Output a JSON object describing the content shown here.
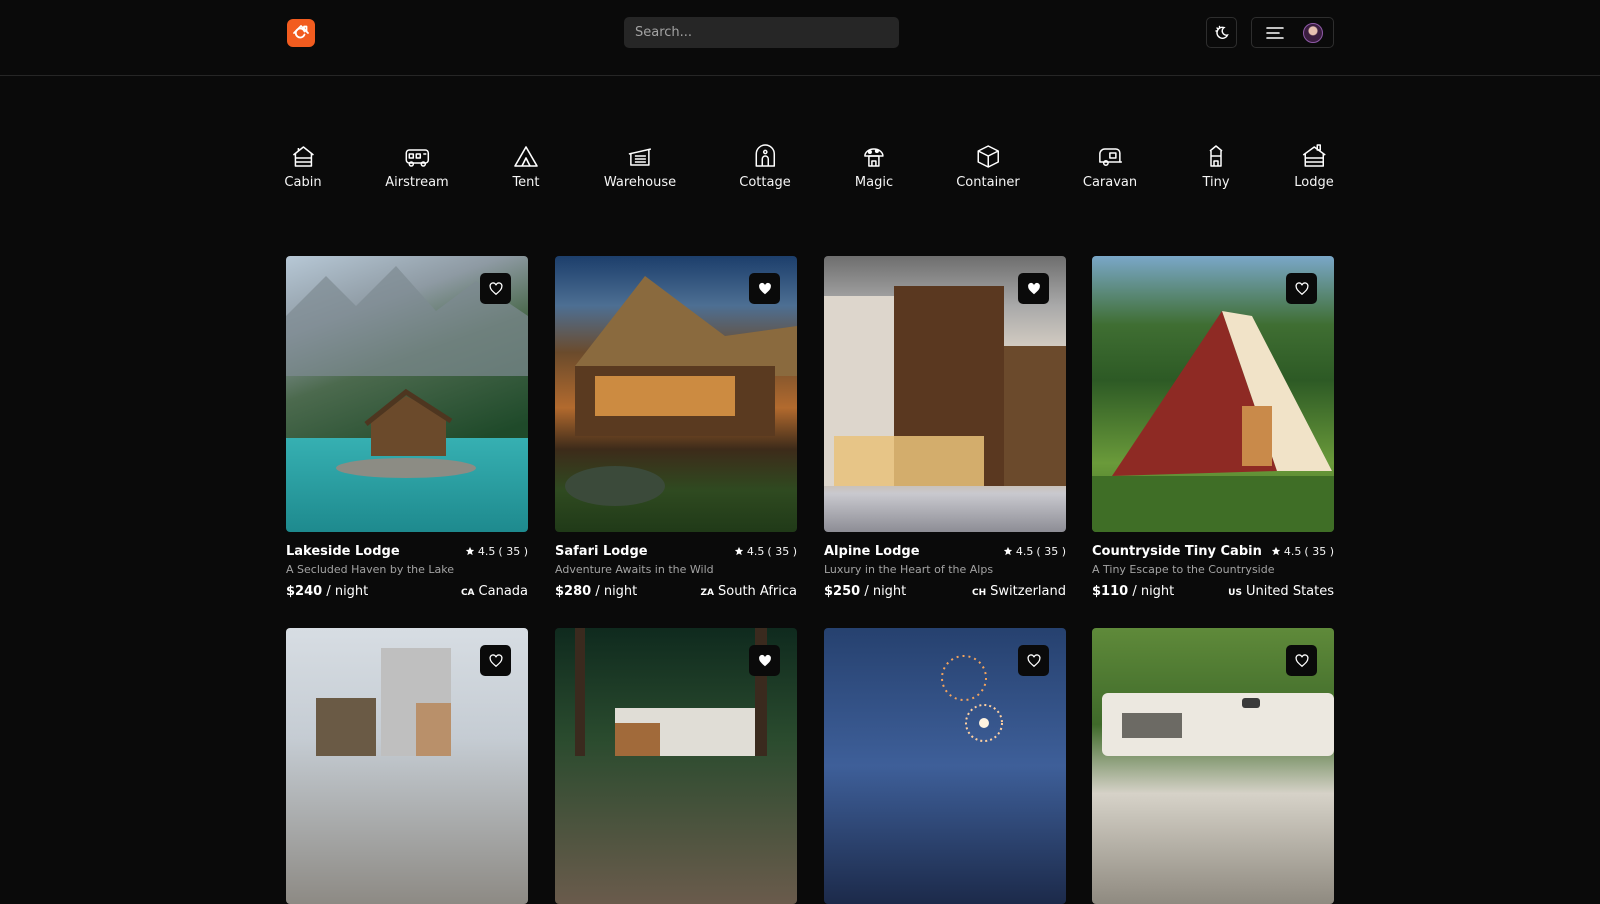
{
  "header": {
    "search_placeholder": "Search..."
  },
  "categories": [
    {
      "label": "Cabin",
      "icon": "cabin-icon"
    },
    {
      "label": "Airstream",
      "icon": "airstream-icon"
    },
    {
      "label": "Tent",
      "icon": "tent-icon"
    },
    {
      "label": "Warehouse",
      "icon": "warehouse-icon"
    },
    {
      "label": "Cottage",
      "icon": "cottage-icon"
    },
    {
      "label": "Magic",
      "icon": "magic-icon"
    },
    {
      "label": "Container",
      "icon": "container-icon"
    },
    {
      "label": "Caravan",
      "icon": "caravan-icon"
    },
    {
      "label": "Tiny",
      "icon": "tiny-icon"
    },
    {
      "label": "Lodge",
      "icon": "lodge-icon"
    }
  ],
  "listings": [
    {
      "title": "Lakeside Lodge",
      "rating": "4.5",
      "reviews": "( 35 )",
      "subtitle": "A Secluded Haven by the Lake",
      "price": "$240",
      "per": " / night",
      "country_code": "CA",
      "country": "Canada"
    },
    {
      "title": "Safari Lodge",
      "rating": "4.5",
      "reviews": "( 35 )",
      "subtitle": "Adventure Awaits in the Wild",
      "price": "$280",
      "per": " / night",
      "country_code": "ZA",
      "country": "South Africa"
    },
    {
      "title": "Alpine Lodge",
      "rating": "4.5",
      "reviews": "( 35 )",
      "subtitle": "Luxury in the Heart of the Alps",
      "price": "$250",
      "per": " / night",
      "country_code": "CH",
      "country": "Switzerland"
    },
    {
      "title": "Countryside Tiny Cabin",
      "rating": "4.5",
      "reviews": "( 35 )",
      "subtitle": "A Tiny Escape to the Countryside",
      "price": "$110",
      "per": " / night",
      "country_code": "US",
      "country": "United States"
    }
  ],
  "colors": {
    "background": "#0a0a0a",
    "accent": "#f25c1f",
    "muted_text": "#a3a3a3"
  }
}
